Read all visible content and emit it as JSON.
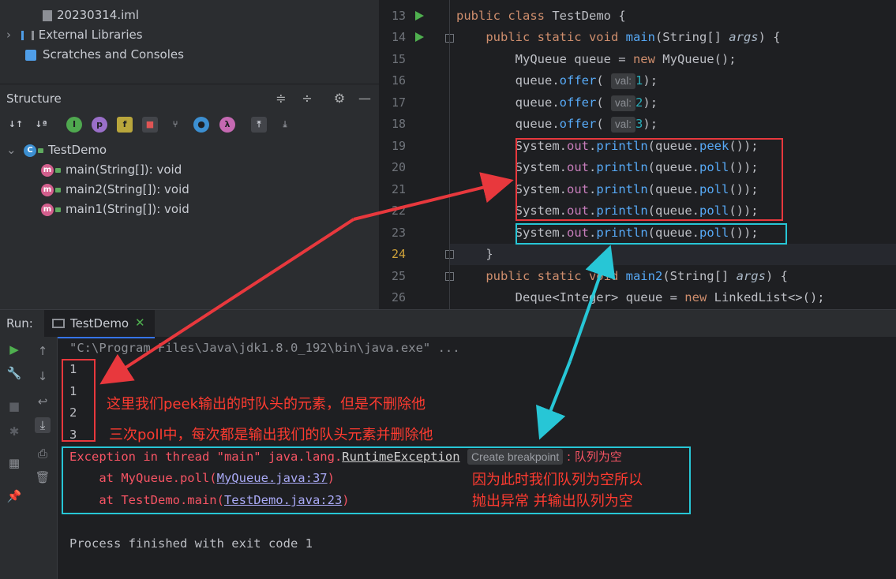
{
  "project_tree": {
    "items": [
      {
        "label": "20230314.iml",
        "icon": "iml-file-icon"
      },
      {
        "label": "External Libraries",
        "icon": "libraries-icon"
      },
      {
        "label": "Scratches and Consoles",
        "icon": "scratches-icon"
      }
    ]
  },
  "structure": {
    "title": "Structure",
    "class_name": "TestDemo",
    "methods": [
      "main(String[]): void",
      "main2(String[]): void",
      "main1(String[]): void"
    ]
  },
  "editor": {
    "line_numbers": [
      "13",
      "14",
      "15",
      "16",
      "17",
      "18",
      "19",
      "20",
      "21",
      "22",
      "23",
      "24",
      "25",
      "26"
    ],
    "param_hint": "val:",
    "lines": {
      "l13": {
        "kw": "public class ",
        "name": "TestDemo",
        "brace": " {"
      },
      "l14": {
        "kw": "public static void ",
        "fn": "main",
        "open": "(String[] ",
        "param": "args",
        "close": ") {"
      },
      "l15": {
        "a": "MyQueue queue = ",
        "kw": "new ",
        "b": "MyQueue();"
      },
      "l16": {
        "a": "queue.",
        "m": "offer",
        "b": "(",
        "v": "1",
        "c": ");"
      },
      "l17": {
        "a": "queue.",
        "m": "offer",
        "b": "(",
        "v": "2",
        "c": ");"
      },
      "l18": {
        "a": "queue.",
        "m": "offer",
        "b": "(",
        "v": "3",
        "c": ");"
      },
      "l19": {
        "a": "System.",
        "f": "out",
        "b": ".",
        "m": "println",
        "c": "(queue.",
        "m2": "peek",
        "d": "());"
      },
      "l20": {
        "a": "System.",
        "f": "out",
        "b": ".",
        "m": "println",
        "c": "(queue.",
        "m2": "poll",
        "d": "());"
      },
      "l21": {
        "a": "System.",
        "f": "out",
        "b": ".",
        "m": "println",
        "c": "(queue.",
        "m2": "poll",
        "d": "());"
      },
      "l22": {
        "a": "System.",
        "f": "out",
        "b": ".",
        "m": "println",
        "c": "(queue.",
        "m2": "poll",
        "d": "());"
      },
      "l23": {
        "a": "System.",
        "f": "out",
        "b": ".",
        "m": "println",
        "c": "(queue.",
        "m2": "poll",
        "d": "());"
      },
      "l24": {
        "a": "}"
      },
      "l25": {
        "kw": "public static void ",
        "fn": "main2",
        "open": "(String[] ",
        "param": "args",
        "close": ") {"
      },
      "l26": {
        "a": "Deque<Integer> queue = ",
        "kw": "new ",
        "b": "LinkedList<>();"
      }
    }
  },
  "run": {
    "label": "Run:",
    "tab": "TestDemo",
    "cmd": "\"C:\\Program Files\\Java\\jdk1.8.0_192\\bin\\java.exe\" ...",
    "outputs": [
      "1",
      "1",
      "2",
      "3"
    ],
    "exception_prefix": "Exception in thread \"main\" java.lang.",
    "exception_class": "RuntimeException",
    "create_breakpoint": "Create breakpoint",
    "exception_msg": " : 队列为空",
    "trace1_prefix": "    at MyQueue.poll(",
    "trace1_link": "MyQueue.java:37",
    "trace2_prefix": "    at TestDemo.main(",
    "trace2_link": "TestDemo.java:23",
    "close_paren": ")",
    "finished": "Process finished with exit code 1"
  },
  "annotations": {
    "note1": "这里我们peek输出的时队头的元素，但是不删除他",
    "note2": "三次poll中，每次都是输出我们的队头元素并删除他",
    "note3a": "因为此时我们队列为空所以",
    "note3b": "抛出异常 并输出队列为空",
    "red": "#e8383d",
    "cyan": "#27c6d6"
  }
}
